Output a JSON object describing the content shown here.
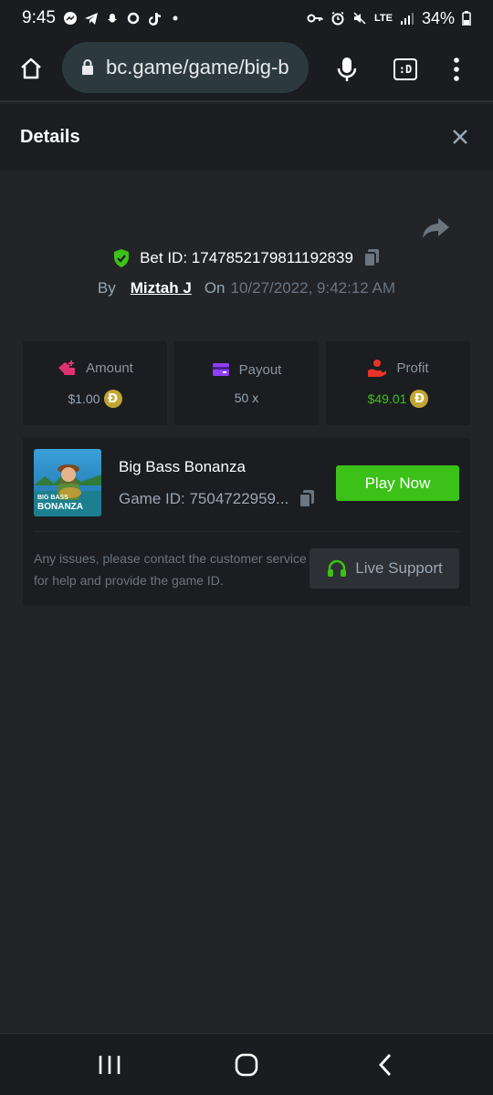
{
  "status_bar": {
    "time": "9:45",
    "network": "LTE",
    "battery": "34%"
  },
  "browser": {
    "url": "bc.game/game/big-b",
    "tab_label": ":D"
  },
  "header": {
    "title": "Details"
  },
  "bet": {
    "label": "Bet ID:",
    "id": "1747852179811192839",
    "by_label": "By",
    "user": "Miztah J",
    "on_label": "On",
    "datetime": "10/27/2022, 9:42:12 AM"
  },
  "stats": [
    {
      "label": "Amount",
      "value": "$1.00",
      "icon": "amount-icon",
      "coin": "Ð"
    },
    {
      "label": "Payout",
      "value": "50 x",
      "icon": "payout-icon"
    },
    {
      "label": "Profit",
      "value": "$49.01",
      "icon": "profit-icon",
      "coin": "Ð"
    }
  ],
  "game": {
    "name": "Big Bass Bonanza",
    "id_label": "Game ID: 7504722959...",
    "play_label": "Play Now",
    "thumb_text_1": "BIG BASS",
    "thumb_text_2": "BONANZA"
  },
  "support": {
    "help_text": "Any issues, please contact the customer service for help and provide the game ID.",
    "button_label": "Live Support"
  },
  "colors": {
    "accent_green": "#3bc117",
    "coin_gold": "#c2a633",
    "background": "#222427",
    "card": "#1b1d20"
  }
}
